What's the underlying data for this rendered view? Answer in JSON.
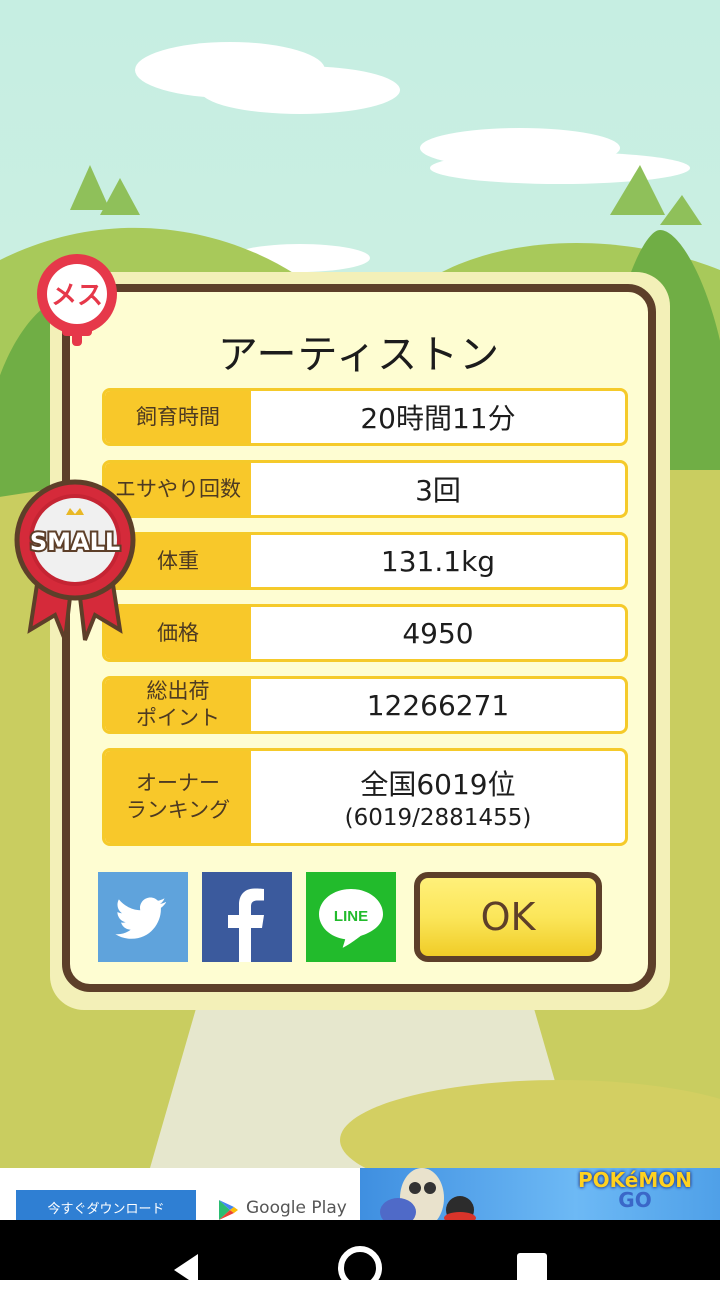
{
  "dialog": {
    "title": "アーティストン",
    "rows": [
      {
        "label": "飼育時間",
        "value": "20時間11分"
      },
      {
        "label": "エサやり回数",
        "value": "3回"
      },
      {
        "label": "体重",
        "value": "131.1kg"
      },
      {
        "label": "価格",
        "value": "4950"
      },
      {
        "label_line1": "総出荷",
        "label_line2": "ポイント",
        "value": "12266271"
      },
      {
        "label_line1": "オーナー",
        "label_line2": "ランキング",
        "value": "全国6019位",
        "sub": "(6019/2881455)"
      }
    ],
    "ok_label": "OK"
  },
  "badges": {
    "gender": "メス",
    "size": "SMALL"
  },
  "social": {
    "line_label": "LINE"
  },
  "ad": {
    "download_label": "今すぐダウンロード",
    "store_label": "Google Play",
    "logo_line1": "POKéMON",
    "logo_line2": "GO"
  },
  "colors": {
    "frame": "#5d3f29",
    "label_bg": "#f8c82a",
    "panel_bg": "#fefdd2",
    "twitter": "#5fa3dc",
    "facebook": "#3b5a9d",
    "line": "#22bb2c"
  }
}
